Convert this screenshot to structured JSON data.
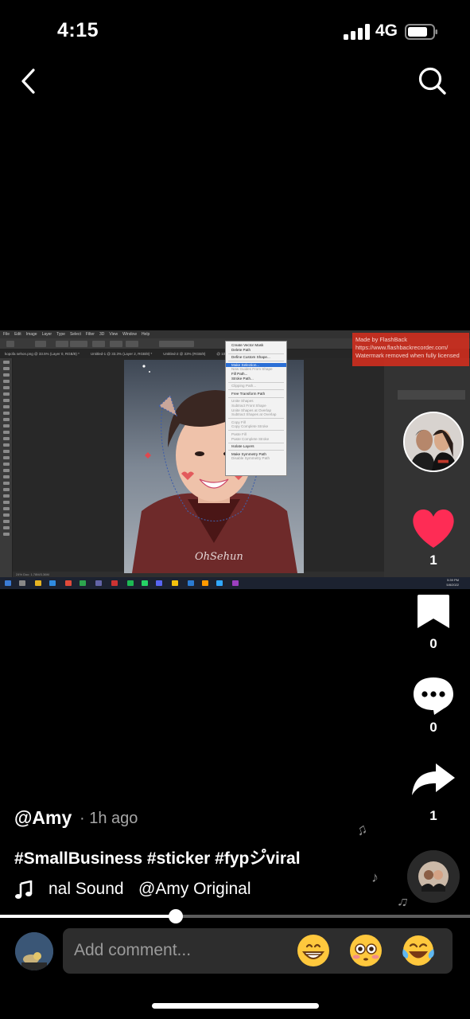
{
  "status_bar": {
    "time": "4:15",
    "network": "4G"
  },
  "video": {
    "ps_menu": [
      "File",
      "Edit",
      "Image",
      "Layer",
      "Type",
      "Select",
      "Filter",
      "3D",
      "View",
      "Window",
      "Help"
    ],
    "ps_tabs": [
      "kopofa sehon.png @ 33.5% (Layer 0, RGB/8) *",
      "Untitled-1 @ 33.3% (Layer 2, RGB/8) *",
      "Untitled-2 @ 33% (RGB/8)",
      "@ 100% (RGB/8)"
    ],
    "context_menu": [
      {
        "label": "Create Vector Mask",
        "state": "normal"
      },
      {
        "label": "Delete Path",
        "state": "normal"
      },
      {
        "sep": true
      },
      {
        "label": "Define Custom Shape...",
        "state": "normal"
      },
      {
        "sep": true
      },
      {
        "label": "Make Selection...",
        "state": "highlight"
      },
      {
        "label": "New Guides From Shape",
        "state": "dim"
      },
      {
        "label": "Fill Path...",
        "state": "normal"
      },
      {
        "label": "Stroke Path...",
        "state": "normal"
      },
      {
        "sep": true
      },
      {
        "label": "Clipping Path...",
        "state": "dim"
      },
      {
        "sep": true
      },
      {
        "label": "Free Transform Path",
        "state": "normal"
      },
      {
        "sep": true
      },
      {
        "label": "Unite Shapes",
        "state": "dim"
      },
      {
        "label": "Subtract Front Shape",
        "state": "dim"
      },
      {
        "label": "Unite Shapes at Overlap",
        "state": "dim"
      },
      {
        "label": "Subtract Shapes at Overlap",
        "state": "dim"
      },
      {
        "sep": true
      },
      {
        "label": "Copy Fill",
        "state": "dim"
      },
      {
        "label": "Copy Complete Stroke",
        "state": "dim"
      },
      {
        "sep": true
      },
      {
        "label": "Paste Fill",
        "state": "dim"
      },
      {
        "label": "Paste Complete Stroke",
        "state": "dim"
      },
      {
        "sep": true
      },
      {
        "label": "Isolate Layers",
        "state": "normal"
      },
      {
        "sep": true
      },
      {
        "label": "Make Symmetry Path",
        "state": "normal"
      },
      {
        "label": "Disable Symmetry Path",
        "state": "dim"
      }
    ],
    "watermark": [
      "Made by FlashBack",
      "https://www.flashbackrecorder.com/",
      "Watermark removed when fully licensed"
    ],
    "photo_credit": "OhSehun",
    "ps_status": "24% Doc: 1.78M/3.36M",
    "taskbar_clock": [
      "5:39 PM",
      "5/8/2022"
    ]
  },
  "rail": {
    "likes": "1",
    "saves": "0",
    "comments": "0",
    "shares": "1"
  },
  "post": {
    "username": "@Amy",
    "time_ago": "· 1h ago",
    "caption": "#SmallBusiness #sticker #fypシ゚viral",
    "music_fragment": "nal Sound",
    "music_full": "@Amy Original"
  },
  "playback": {
    "progress": 0.374
  },
  "comment": {
    "placeholder": "Add comment...",
    "emojis": [
      "grinning-face-emoji",
      "flushed-face-emoji",
      "tears-of-joy-emoji"
    ]
  },
  "colors": {
    "like_red": "#fe2c55",
    "watermark_red": "#d42d1e"
  }
}
